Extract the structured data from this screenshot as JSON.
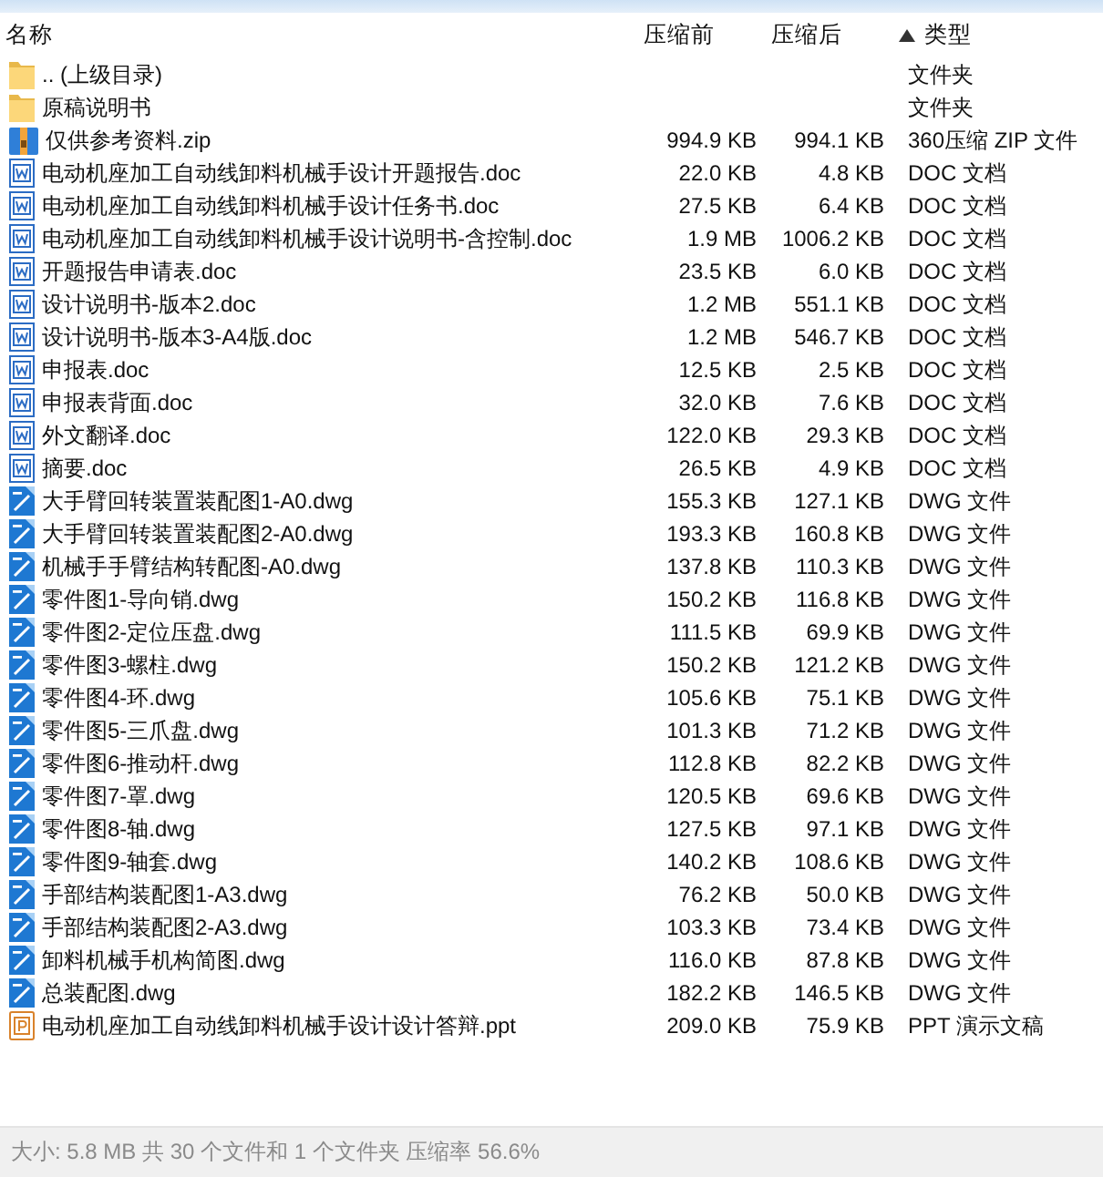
{
  "table": {
    "columns": [
      {
        "label": "名称",
        "sorted": false
      },
      {
        "label": "压缩前",
        "sorted": false
      },
      {
        "label": "压缩后",
        "sorted": false
      },
      {
        "label": "类型",
        "sorted": true
      }
    ],
    "rows": [
      {
        "kind": "folder",
        "name": ".. (上级目录)",
        "type": "文件夹"
      },
      {
        "kind": "folder",
        "name": "原稿说明书",
        "type": "文件夹"
      },
      {
        "kind": "zip",
        "name": "仅供参考资料.zip",
        "size_before": "994.9 KB",
        "size_after": "994.1 KB",
        "type": "360压缩 ZIP 文件"
      },
      {
        "kind": "doc",
        "name": "电动机座加工自动线卸料机械手设计开题报告.doc",
        "size_before": "22.0 KB",
        "size_after": "4.8 KB",
        "type": "DOC 文档"
      },
      {
        "kind": "doc",
        "name": "电动机座加工自动线卸料机械手设计任务书.doc",
        "size_before": "27.5 KB",
        "size_after": "6.4 KB",
        "type": "DOC 文档"
      },
      {
        "kind": "doc",
        "name": "电动机座加工自动线卸料机械手设计说明书-含控制.doc",
        "size_before": "1.9 MB",
        "size_after": "1006.2 KB",
        "type": "DOC 文档"
      },
      {
        "kind": "doc",
        "name": "开题报告申请表.doc",
        "size_before": "23.5 KB",
        "size_after": "6.0 KB",
        "type": "DOC 文档"
      },
      {
        "kind": "doc",
        "name": "设计说明书-版本2.doc",
        "size_before": "1.2 MB",
        "size_after": "551.1 KB",
        "type": "DOC 文档"
      },
      {
        "kind": "doc",
        "name": "设计说明书-版本3-A4版.doc",
        "size_before": "1.2 MB",
        "size_after": "546.7 KB",
        "type": "DOC 文档"
      },
      {
        "kind": "doc",
        "name": "申报表.doc",
        "size_before": "12.5 KB",
        "size_after": "2.5 KB",
        "type": "DOC 文档"
      },
      {
        "kind": "doc",
        "name": "申报表背面.doc",
        "size_before": "32.0 KB",
        "size_after": "7.6 KB",
        "type": "DOC 文档"
      },
      {
        "kind": "doc",
        "name": "外文翻译.doc",
        "size_before": "122.0 KB",
        "size_after": "29.3 KB",
        "type": "DOC 文档"
      },
      {
        "kind": "doc",
        "name": "摘要.doc",
        "size_before": "26.5 KB",
        "size_after": "4.9 KB",
        "type": "DOC 文档"
      },
      {
        "kind": "dwg",
        "name": "大手臂回转装置装配图1-A0.dwg",
        "size_before": "155.3 KB",
        "size_after": "127.1 KB",
        "type": "DWG 文件"
      },
      {
        "kind": "dwg",
        "name": "大手臂回转装置装配图2-A0.dwg",
        "size_before": "193.3 KB",
        "size_after": "160.8 KB",
        "type": "DWG 文件"
      },
      {
        "kind": "dwg",
        "name": "机械手手臂结构转配图-A0.dwg",
        "size_before": "137.8 KB",
        "size_after": "110.3 KB",
        "type": "DWG 文件"
      },
      {
        "kind": "dwg",
        "name": "零件图1-导向销.dwg",
        "size_before": "150.2 KB",
        "size_after": "116.8 KB",
        "type": "DWG 文件"
      },
      {
        "kind": "dwg",
        "name": "零件图2-定位压盘.dwg",
        "size_before": "111.5 KB",
        "size_after": "69.9 KB",
        "type": "DWG 文件"
      },
      {
        "kind": "dwg",
        "name": "零件图3-螺柱.dwg",
        "size_before": "150.2 KB",
        "size_after": "121.2 KB",
        "type": "DWG 文件"
      },
      {
        "kind": "dwg",
        "name": "零件图4-环.dwg",
        "size_before": "105.6 KB",
        "size_after": "75.1 KB",
        "type": "DWG 文件"
      },
      {
        "kind": "dwg",
        "name": "零件图5-三爪盘.dwg",
        "size_before": "101.3 KB",
        "size_after": "71.2 KB",
        "type": "DWG 文件"
      },
      {
        "kind": "dwg",
        "name": "零件图6-推动杆.dwg",
        "size_before": "112.8 KB",
        "size_after": "82.2 KB",
        "type": "DWG 文件"
      },
      {
        "kind": "dwg",
        "name": "零件图7-罩.dwg",
        "size_before": "120.5 KB",
        "size_after": "69.6 KB",
        "type": "DWG 文件"
      },
      {
        "kind": "dwg",
        "name": "零件图8-轴.dwg",
        "size_before": "127.5 KB",
        "size_after": "97.1 KB",
        "type": "DWG 文件"
      },
      {
        "kind": "dwg",
        "name": "零件图9-轴套.dwg",
        "size_before": "140.2 KB",
        "size_after": "108.6 KB",
        "type": "DWG 文件"
      },
      {
        "kind": "dwg",
        "name": "手部结构装配图1-A3.dwg",
        "size_before": "76.2 KB",
        "size_after": "50.0 KB",
        "type": "DWG 文件"
      },
      {
        "kind": "dwg",
        "name": "手部结构装配图2-A3.dwg",
        "size_before": "103.3 KB",
        "size_after": "73.4 KB",
        "type": "DWG 文件"
      },
      {
        "kind": "dwg",
        "name": "卸料机械手机构简图.dwg",
        "size_before": "116.0 KB",
        "size_after": "87.8 KB",
        "type": "DWG 文件"
      },
      {
        "kind": "dwg",
        "name": "总装配图.dwg",
        "size_before": "182.2 KB",
        "size_after": "146.5 KB",
        "type": "DWG 文件"
      },
      {
        "kind": "ppt",
        "name": "电动机座加工自动线卸料机械手设计设计答辩.ppt",
        "size_before": "209.0 KB",
        "size_after": "75.9 KB",
        "type": "PPT 演示文稿"
      }
    ]
  },
  "status_bar": {
    "text": "大小: 5.8 MB 共 30 个文件和 1 个文件夹 压缩率 56.6%"
  }
}
